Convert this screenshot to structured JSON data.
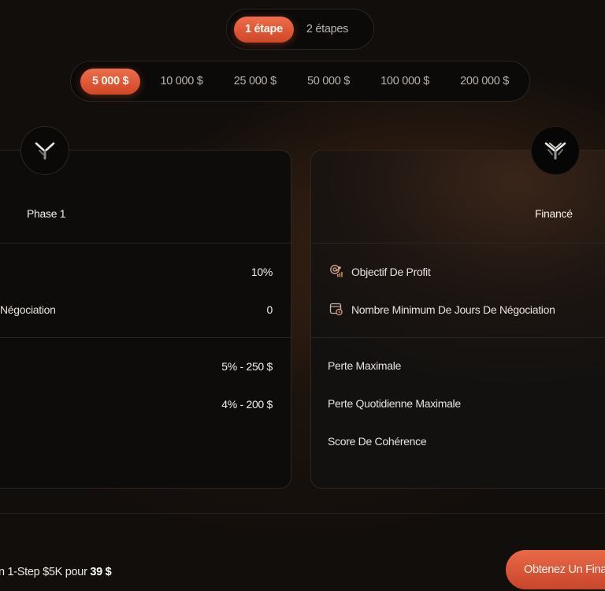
{
  "step_toggle": {
    "options": [
      {
        "label": "1 étape",
        "active": true
      },
      {
        "label": "2 étapes",
        "active": false
      }
    ]
  },
  "account_sizes": {
    "options": [
      {
        "label": "5 000 $",
        "active": true
      },
      {
        "label": "10 000 $",
        "active": false
      },
      {
        "label": "25 000 $",
        "active": false
      },
      {
        "label": "50 000 $",
        "active": false
      },
      {
        "label": "100 000 $",
        "active": false
      },
      {
        "label": "200 000 $",
        "active": false
      }
    ]
  },
  "phase_card": {
    "title": "Phase 1",
    "row_profit_value": "10%",
    "row_min_days_label_partial": "Négociation",
    "row_min_days_value": "0",
    "row_max_loss_value": "5% - 250 $",
    "row_daily_loss_value": "4% - 200 $"
  },
  "funded_card": {
    "title": "Financé",
    "row_profit_label": "Objectif De Profit",
    "row_min_days_label": "Nombre Minimum De Jours De Négociation",
    "row_max_loss_label": "Perte Maximale",
    "row_daily_loss_label": "Perte Quotidienne Maximale",
    "row_consistency_label": "Score De Cohérence"
  },
  "footer": {
    "cta_text_prefix": "n 1-Step $5K pour ",
    "cta_price": "39 $",
    "cta_button_label": "Obtenez Un Fina"
  },
  "icons": {
    "badge_left": "y-logo-icon",
    "badge_right": "crown-logo-icon",
    "profit": "target-chart-icon",
    "calendar": "calendar-clock-icon"
  },
  "colors": {
    "accent": "#e0593a",
    "background": "#120e0b"
  }
}
